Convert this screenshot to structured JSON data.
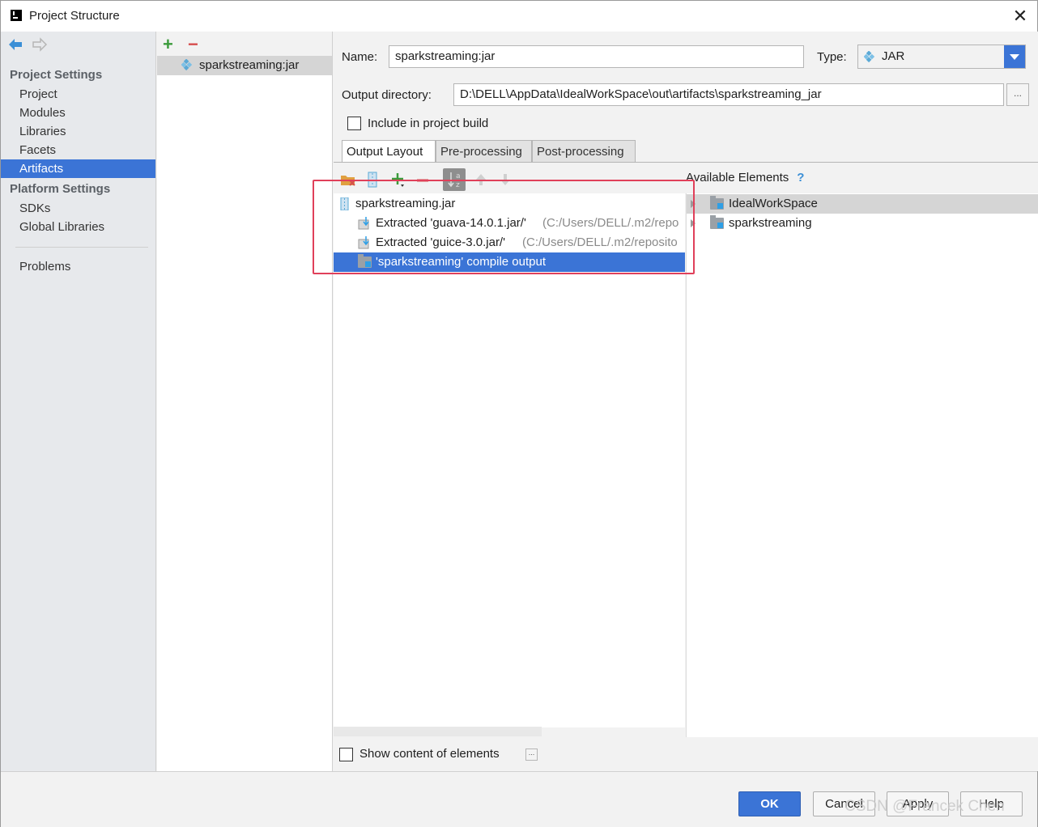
{
  "window": {
    "title": "Project Structure",
    "close_glyph": "✕"
  },
  "nav": {
    "project_settings_header": "Project Settings",
    "project_settings_items": [
      "Project",
      "Modules",
      "Libraries",
      "Facets",
      "Artifacts"
    ],
    "selected_item": "Artifacts",
    "platform_settings_header": "Platform Settings",
    "platform_settings_items": [
      "SDKs",
      "Global Libraries"
    ],
    "problems": "Problems"
  },
  "artifacts": {
    "add_glyph": "+",
    "remove_glyph": "−",
    "items": [
      "sparkstreaming:jar"
    ]
  },
  "form": {
    "name_label": "Name:",
    "name_value": "sparkstreaming:jar",
    "type_label": "Type:",
    "type_value": "JAR",
    "output_dir_label": "Output directory:",
    "output_dir_value": "D:\\DELL\\AppData\\IdealWorkSpace\\out\\artifacts\\sparkstreaming_jar",
    "browse_glyph": "...",
    "include_build_label": "Include in project build",
    "include_build_checked": false
  },
  "tabs": [
    "Output Layout",
    "Pre-processing",
    "Post-processing"
  ],
  "active_tab": "Output Layout",
  "output_layout": {
    "root": "sparkstreaming.jar",
    "children": [
      {
        "label": "Extracted 'guava-14.0.1.jar/'",
        "path": "(C:/Users/DELL/.m2/repo"
      },
      {
        "label": "Extracted 'guice-3.0.jar/'",
        "path": "(C:/Users/DELL/.m2/reposito"
      },
      {
        "label": "'sparkstreaming' compile output",
        "path": ""
      }
    ],
    "selected_index": 2
  },
  "available": {
    "header": "Available Elements",
    "help_glyph": "?",
    "items": [
      "IdealWorkSpace",
      "sparkstreaming"
    ]
  },
  "show_content_label": "Show content of elements",
  "buttons": {
    "ok": "OK",
    "cancel": "Cancel",
    "apply": "Apply",
    "help": "Help"
  },
  "watermark": "CSDN @Francek Chen",
  "colors": {
    "accent": "#3b74d6",
    "highlight_box": "#e0405a",
    "add_green": "#3b9b3b",
    "remove_red": "#d64e4e"
  }
}
